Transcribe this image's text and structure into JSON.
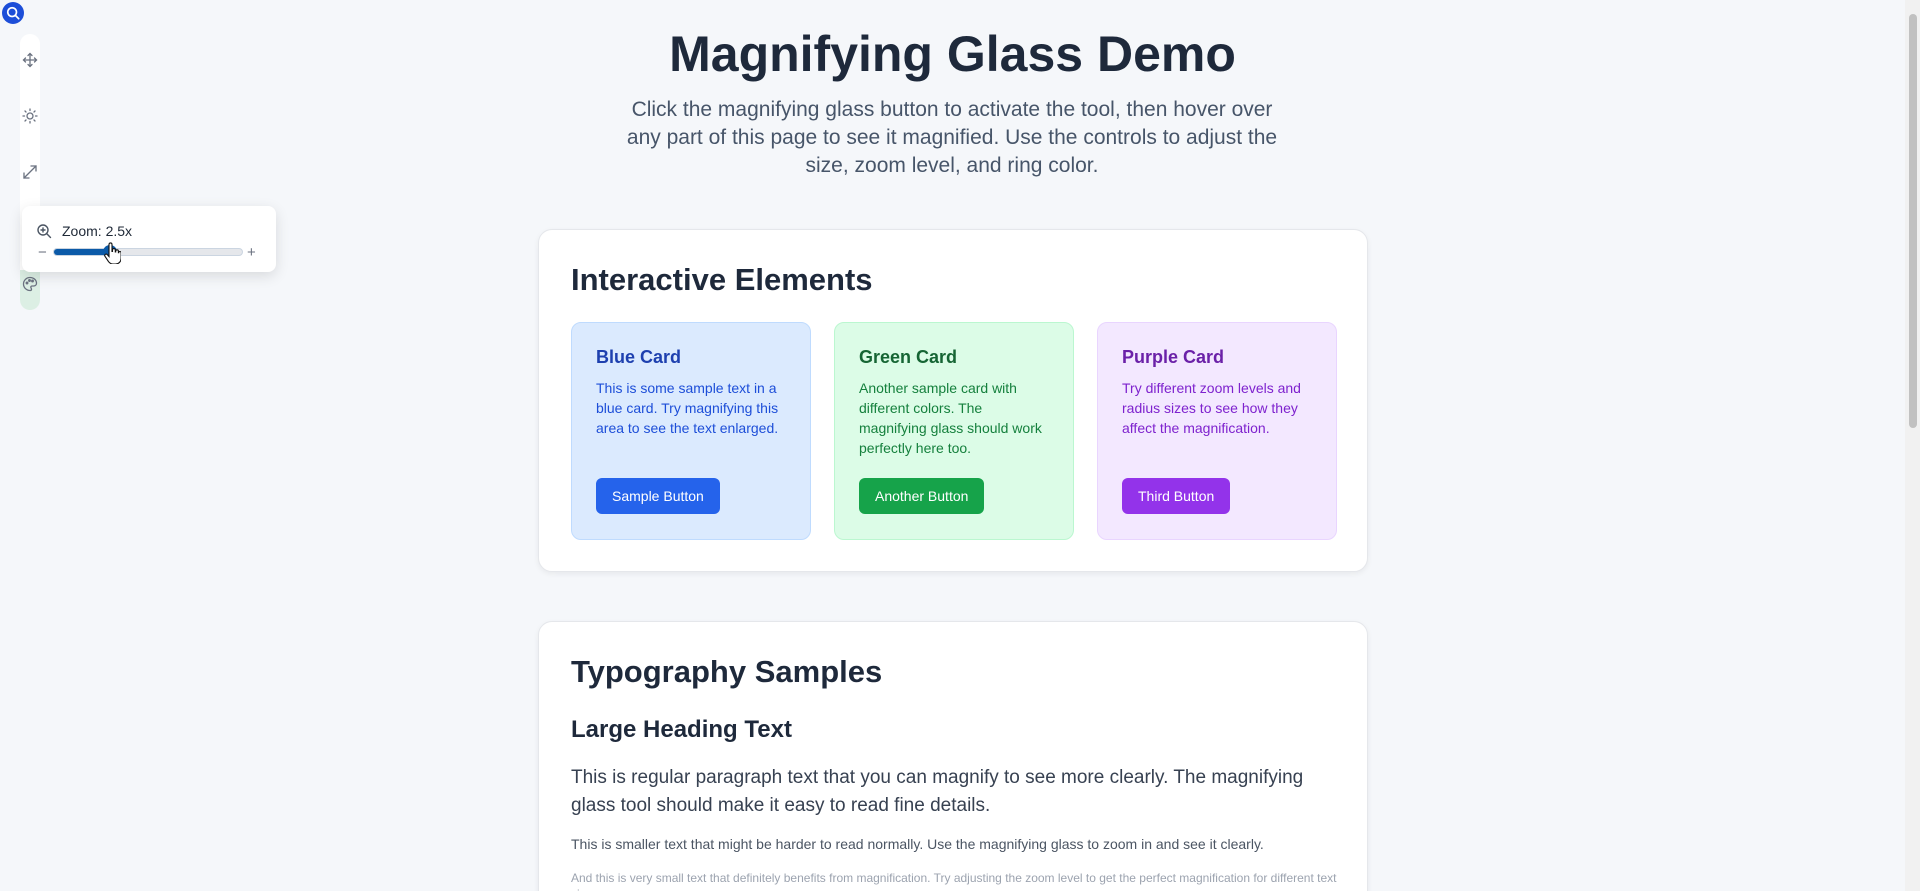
{
  "toolbar": {
    "icons": [
      "magnifier-toggle-icon",
      "move-icon",
      "sun-icon",
      "expand-icon",
      "palette-icon"
    ],
    "accent": "#1d4ed8"
  },
  "zoom_popover": {
    "label": "Zoom: 2.5x",
    "minus": "−",
    "plus": "+",
    "level": 0.3,
    "accent": "#0b5aa8"
  },
  "header": {
    "title": "Magnifying Glass Demo",
    "intro": "Click the magnifying glass button to activate the tool, then hover over any part of this page to see it magnified. Use the controls to adjust the size, zoom level, and ring color."
  },
  "interactive": {
    "title": "Interactive Elements",
    "cards": [
      {
        "title": "Blue Card",
        "text": "This is some sample text in a blue card. Try magnifying this area to see the text enlarged.",
        "button": "Sample Button"
      },
      {
        "title": "Green Card",
        "text": "Another sample card with different colors. The magnifying glass should work perfectly here too.",
        "button": "Another Button"
      },
      {
        "title": "Purple Card",
        "text": "Try different zoom levels and radius sizes to see how they affect the magnification.",
        "button": "Third Button"
      }
    ]
  },
  "typography": {
    "title": "Typography Samples",
    "heading": "Large Heading Text",
    "paragraph": "This is regular paragraph text that you can magnify to see more clearly. The magnifying glass tool should make it easy to read fine details.",
    "small": "This is smaller text that might be harder to read normally. Use the magnifying glass to zoom in and see it clearly.",
    "tiny": "And this is very small text that definitely benefits from magnification. Try adjusting the zoom level to get the perfect magnification for different text sizes."
  }
}
